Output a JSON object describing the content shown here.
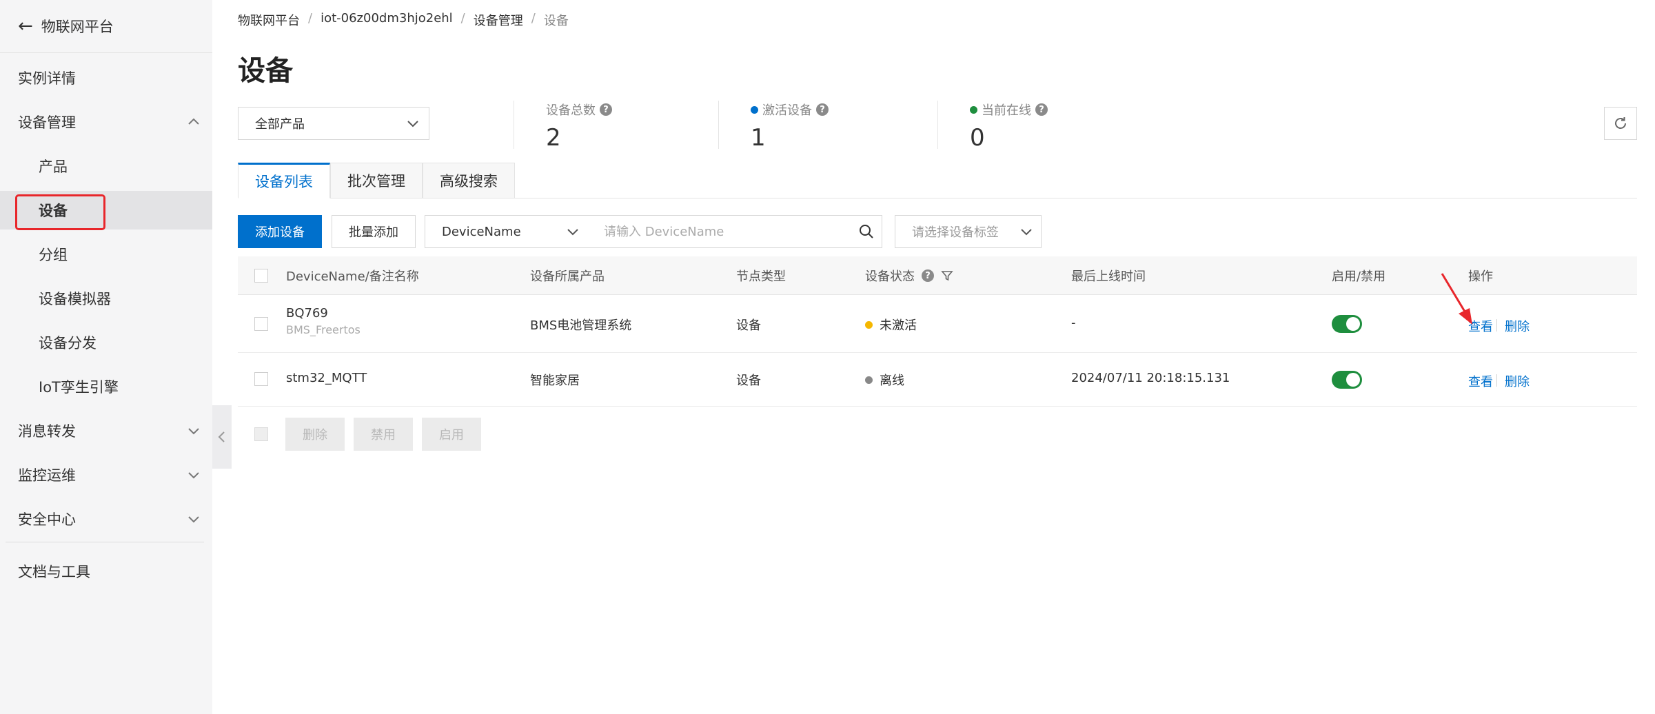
{
  "sidebar": {
    "header_title": "物联网平台",
    "items": [
      {
        "label": "实例详情"
      },
      {
        "label": "设备管理"
      },
      {
        "label": "产品"
      },
      {
        "label": "设备"
      },
      {
        "label": "分组"
      },
      {
        "label": "设备模拟器"
      },
      {
        "label": "设备分发"
      },
      {
        "label": "IoT孪生引擎"
      },
      {
        "label": "消息转发"
      },
      {
        "label": "监控运维"
      },
      {
        "label": "安全中心"
      },
      {
        "label": "文档与工具"
      }
    ]
  },
  "breadcrumb": [
    "物联网平台",
    "iot-06z00dm3hjo2ehl",
    "设备管理",
    "设备"
  ],
  "page_title": "设备",
  "product_select": {
    "value": "全部产品"
  },
  "stats": [
    {
      "label": "设备总数",
      "value": "2"
    },
    {
      "label": "激活设备",
      "value": "1",
      "dot_color": "#0070cc"
    },
    {
      "label": "当前在线",
      "value": "0",
      "dot_color": "#1e8e3e"
    }
  ],
  "tabs": [
    "设备列表",
    "批次管理",
    "高级搜索"
  ],
  "toolbar": {
    "add_device": "添加设备",
    "batch_add": "批量添加",
    "field_select": "DeviceName",
    "search_placeholder": "请输入 DeviceName",
    "tag_placeholder": "请选择设备标签"
  },
  "table": {
    "columns": [
      "DeviceName/备注名称",
      "设备所属产品",
      "节点类型",
      "设备状态",
      "最后上线时间",
      "启用/禁用",
      "操作"
    ],
    "rows": [
      {
        "name": "BQ769",
        "remark": "BMS_Freertos",
        "product": "BMS电池管理系统",
        "node_type": "设备",
        "status": "未激活",
        "status_color": "#f5b700",
        "last_online": "-",
        "enabled": true,
        "view": "查看",
        "delete": "删除"
      },
      {
        "name": "stm32_MQTT",
        "remark": "",
        "product": "智能家居",
        "node_type": "设备",
        "status": "离线",
        "status_color": "#888888",
        "last_online": "2024/07/11 20:18:15.131",
        "enabled": true,
        "view": "查看",
        "delete": "删除"
      }
    ],
    "footer_buttons": [
      "删除",
      "禁用",
      "启用"
    ]
  },
  "colors": {
    "accent": "#0070cc",
    "highlight": "#e8262b"
  }
}
